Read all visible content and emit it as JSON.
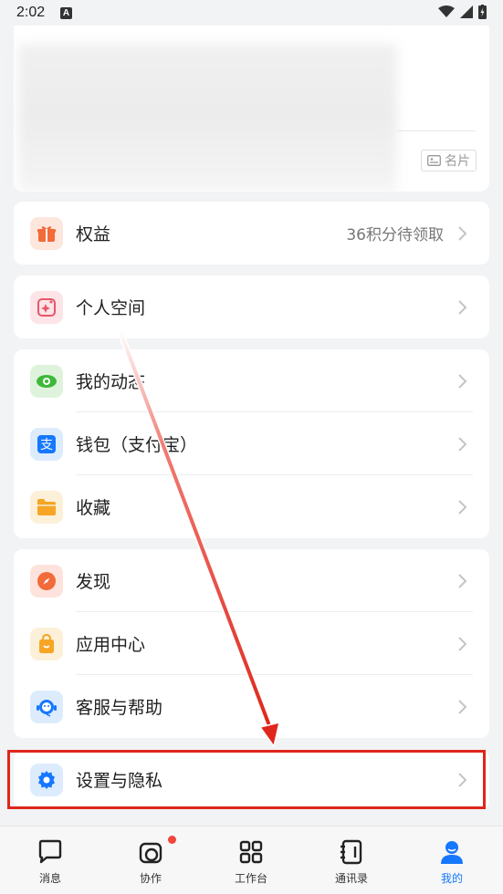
{
  "status_bar": {
    "time": "2:02",
    "notification_badge": "A"
  },
  "profile": {
    "name_card_label": "名片"
  },
  "sections": {
    "rights": {
      "label": "权益",
      "right_text": "36积分待领取"
    },
    "personal_space": {
      "label": "个人空间"
    },
    "group1": [
      {
        "label": "我的动态",
        "icon": "eye-icon"
      },
      {
        "label": "钱包（支付宝）",
        "icon": "alipay-icon"
      },
      {
        "label": "收藏",
        "icon": "folder-icon"
      }
    ],
    "group2": [
      {
        "label": "发现",
        "icon": "compass-icon"
      },
      {
        "label": "应用中心",
        "icon": "bag-icon"
      },
      {
        "label": "客服与帮助",
        "icon": "headset-icon"
      }
    ],
    "settings": {
      "label": "设置与隐私"
    }
  },
  "tabbar": {
    "items": [
      {
        "label": "消息",
        "icon": "chat-bubble-icon",
        "active": false
      },
      {
        "label": "协作",
        "icon": "collab-icon",
        "active": false,
        "badge": true
      },
      {
        "label": "工作台",
        "icon": "grid-icon",
        "active": false
      },
      {
        "label": "通讯录",
        "icon": "contacts-icon",
        "active": false
      },
      {
        "label": "我的",
        "icon": "profile-icon",
        "active": true
      }
    ]
  },
  "colors": {
    "accent": "#1677ff",
    "annotation_red": "#e0261b",
    "badge": "#f0473c"
  }
}
